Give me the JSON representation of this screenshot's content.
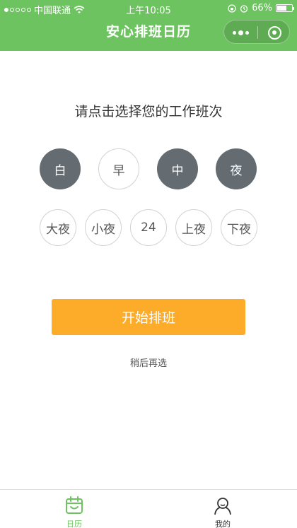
{
  "status_bar": {
    "carrier": "中国联通",
    "time": "上午10:05",
    "battery_text": "66%",
    "battery_level": 0.66
  },
  "nav": {
    "title": "安心排班日历"
  },
  "prompt": "请点击选择您的工作班次",
  "shifts_row1": [
    {
      "label": "白",
      "selected": true
    },
    {
      "label": "早",
      "selected": false
    },
    {
      "label": "中",
      "selected": true
    },
    {
      "label": "夜",
      "selected": true
    }
  ],
  "shifts_row2": [
    {
      "label": "大夜",
      "selected": false
    },
    {
      "label": "小夜",
      "selected": false
    },
    {
      "label": "24",
      "selected": false
    },
    {
      "label": "上夜",
      "selected": false
    },
    {
      "label": "下夜",
      "selected": false
    }
  ],
  "start_button": "开始排班",
  "later_link": "稍后再选",
  "tabs": [
    {
      "label": "日历",
      "icon": "calendar-icon",
      "active": true
    },
    {
      "label": "我的",
      "icon": "user-icon",
      "active": false
    }
  ],
  "colors": {
    "brand_green": "#6cc35f",
    "selected_gray": "#646c72",
    "button_orange": "#fcac28"
  }
}
